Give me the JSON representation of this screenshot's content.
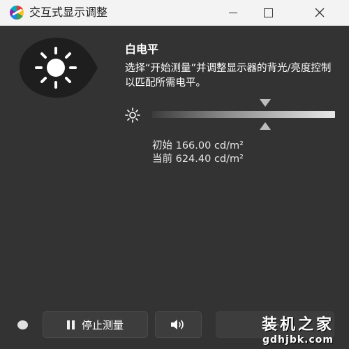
{
  "window": {
    "title": "交互式显示调整",
    "icons": {
      "app": "colorimeter-app-icon",
      "minimize": "minimize-icon",
      "maximize": "maximize-icon",
      "close": "close-icon"
    }
  },
  "panel": {
    "heading": "白电平",
    "description": "选择“开始测量”并调整显示器的背光/亮度控制以匹配所需电平。",
    "badge_icon": "sun-icon"
  },
  "slider": {
    "icon": "brightness-icon",
    "target_fraction": 0.62,
    "current_fraction": 0.62
  },
  "readouts": {
    "initial": "初始 166.00 cd/m²",
    "current": "当前 624.40 cd/m²"
  },
  "footer": {
    "stop_button_label": "停止测量",
    "stop_icon": "pause-icon",
    "sound_icon": "speaker-icon",
    "next_icon": "fast-forward-icon",
    "status_icon": "status-dot-icon"
  },
  "watermark": {
    "cn": "装机之家",
    "url": "gdhjbk.com"
  },
  "colors": {
    "background": "#333333",
    "titlebar": "#f3f3f3",
    "text": "#ffffff"
  }
}
